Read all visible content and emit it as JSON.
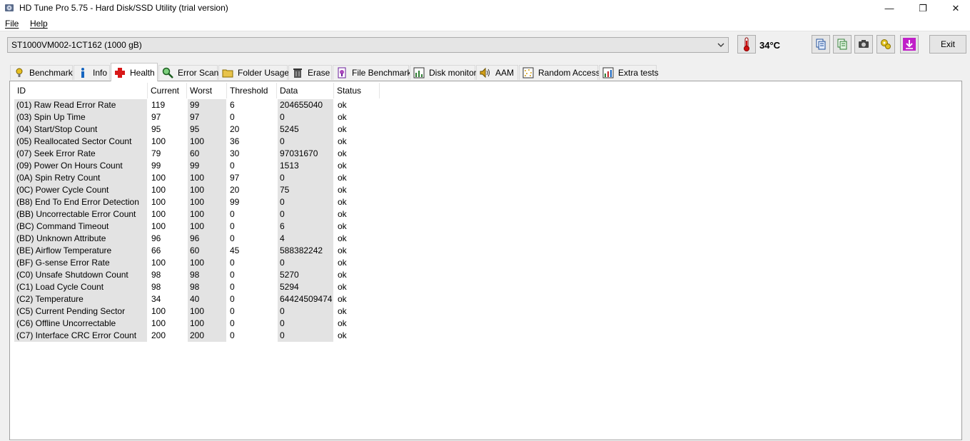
{
  "window": {
    "title": "HD Tune Pro 5.75 - Hard Disk/SSD Utility (trial version)",
    "controls": {
      "minimize": "—",
      "maximize": "❐",
      "close": "✕"
    }
  },
  "menu": {
    "file": "File",
    "help": "Help"
  },
  "toolbar": {
    "drive": "ST1000VM002-1CT162 (1000 gB)",
    "temperature": "34°C",
    "exit_label": "Exit",
    "buttons": [
      "copy-info-icon",
      "copy-text-icon",
      "screenshot-camera-icon",
      "options-icon",
      "save-download-icon"
    ]
  },
  "tabs": [
    {
      "label": "Benchmark",
      "icon": "benchmark-icon",
      "active": false
    },
    {
      "label": "Info",
      "icon": "info-icon",
      "active": false
    },
    {
      "label": "Health",
      "icon": "health-cross-icon",
      "active": true
    },
    {
      "label": "Error Scan",
      "icon": "magnifier-icon",
      "active": false
    },
    {
      "label": "Folder Usage",
      "icon": "folder-icon",
      "active": false
    },
    {
      "label": "Erase",
      "icon": "trash-icon",
      "active": false
    },
    {
      "label": "File Benchmark",
      "icon": "file-benchmark-icon",
      "active": false
    },
    {
      "label": "Disk monitor",
      "icon": "disk-monitor-icon",
      "active": false
    },
    {
      "label": "AAM",
      "icon": "speaker-icon",
      "active": false
    },
    {
      "label": "Random Access",
      "icon": "random-access-icon",
      "active": false
    },
    {
      "label": "Extra tests",
      "icon": "extra-tests-icon",
      "active": false
    }
  ],
  "health_table": {
    "columns": [
      "ID",
      "Current",
      "Worst",
      "Threshold",
      "Data",
      "Status"
    ],
    "rows": [
      [
        "(01) Raw Read Error Rate",
        "119",
        "99",
        "6",
        "204655040",
        "ok"
      ],
      [
        "(03) Spin Up Time",
        "97",
        "97",
        "0",
        "0",
        "ok"
      ],
      [
        "(04) Start/Stop Count",
        "95",
        "95",
        "20",
        "5245",
        "ok"
      ],
      [
        "(05) Reallocated Sector Count",
        "100",
        "100",
        "36",
        "0",
        "ok"
      ],
      [
        "(07) Seek Error Rate",
        "79",
        "60",
        "30",
        "97031670",
        "ok"
      ],
      [
        "(09) Power On Hours Count",
        "99",
        "99",
        "0",
        "1513",
        "ok"
      ],
      [
        "(0A) Spin Retry Count",
        "100",
        "100",
        "97",
        "0",
        "ok"
      ],
      [
        "(0C) Power Cycle Count",
        "100",
        "100",
        "20",
        "75",
        "ok"
      ],
      [
        "(B8) End To End Error Detection",
        "100",
        "100",
        "99",
        "0",
        "ok"
      ],
      [
        "(BB) Uncorrectable Error Count",
        "100",
        "100",
        "0",
        "0",
        "ok"
      ],
      [
        "(BC) Command Timeout",
        "100",
        "100",
        "0",
        "6",
        "ok"
      ],
      [
        "(BD) Unknown Attribute",
        "96",
        "96",
        "0",
        "4",
        "ok"
      ],
      [
        "(BE) Airflow Temperature",
        "66",
        "60",
        "45",
        "588382242",
        "ok"
      ],
      [
        "(BF) G-sense Error Rate",
        "100",
        "100",
        "0",
        "0",
        "ok"
      ],
      [
        "(C0) Unsafe Shutdown Count",
        "98",
        "98",
        "0",
        "5270",
        "ok"
      ],
      [
        "(C1) Load Cycle Count",
        "98",
        "98",
        "0",
        "5294",
        "ok"
      ],
      [
        "(C2) Temperature",
        "34",
        "40",
        "0",
        "64424509474",
        "ok"
      ],
      [
        "(C5) Current Pending Sector",
        "100",
        "100",
        "0",
        "0",
        "ok"
      ],
      [
        "(C6) Offline Uncorrectable",
        "100",
        "100",
        "0",
        "0",
        "ok"
      ],
      [
        "(C7) Interface CRC Error Count",
        "200",
        "200",
        "0",
        "0",
        "ok"
      ]
    ]
  }
}
